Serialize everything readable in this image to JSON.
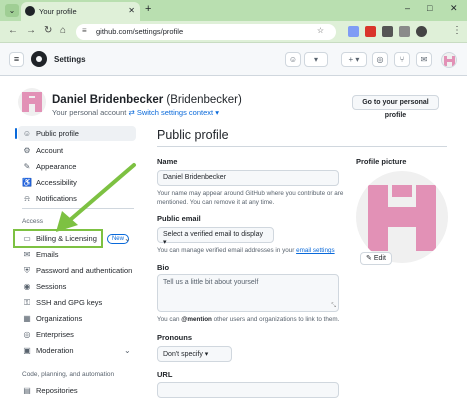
{
  "browser": {
    "tab_title": "Your profile",
    "url": "github.com/settings/profile"
  },
  "github": {
    "page_title": "Settings"
  },
  "user": {
    "display_name": "Daniel Bridenbecker",
    "login": "(Bridenbecker)",
    "account_type": "Your personal account",
    "switch_context": "Switch settings context ▾",
    "goto_profile": "Go to your personal profile"
  },
  "sidebar": {
    "items_top": [
      {
        "label": "Public profile",
        "icon": "person-icon"
      },
      {
        "label": "Account",
        "icon": "gear-icon"
      },
      {
        "label": "Appearance",
        "icon": "paintbrush-icon"
      },
      {
        "label": "Accessibility",
        "icon": "accessibility-icon"
      },
      {
        "label": "Notifications",
        "icon": "bell-icon"
      }
    ],
    "access_heading": "Access",
    "billing_label": "Billing & Licensing",
    "new_badge": "New",
    "items_access": [
      {
        "label": "Emails",
        "icon": "mail-icon"
      },
      {
        "label": "Password and authentication",
        "icon": "shield-lock-icon"
      },
      {
        "label": "Sessions",
        "icon": "broadcast-icon"
      },
      {
        "label": "SSH and GPG keys",
        "icon": "key-icon"
      },
      {
        "label": "Organizations",
        "icon": "organization-icon"
      },
      {
        "label": "Enterprises",
        "icon": "globe-icon"
      },
      {
        "label": "Moderation",
        "icon": "report-icon"
      }
    ],
    "code_heading": "Code, planning, and automation",
    "repositories_label": "Repositories"
  },
  "main": {
    "title": "Public profile",
    "name_label": "Name",
    "name_value": "Daniel Bridenbecker",
    "name_help": "Your name may appear around GitHub where you contribute or are mentioned. You can remove it at any time.",
    "email_label": "Public email",
    "email_select": "Select a verified email to display ▾",
    "email_help": "You can manage verified email addresses in your",
    "email_help_link": "email settings",
    "bio_label": "Bio",
    "bio_placeholder": "Tell us a little bit about yourself",
    "bio_help_pre": "You can",
    "bio_help_mention": "@mention",
    "bio_help_post": "other users and organizations to link to them.",
    "pronouns_label": "Pronouns",
    "pronouns_value": "Don't specify ▾",
    "url_label": "URL",
    "pic_label": "Profile picture",
    "edit_label": "Edit"
  },
  "colors": {
    "accent": "#0969da",
    "identicon": "#e291b6",
    "annotation": "#7dc142",
    "browser_frame": "#b9dfb0"
  }
}
